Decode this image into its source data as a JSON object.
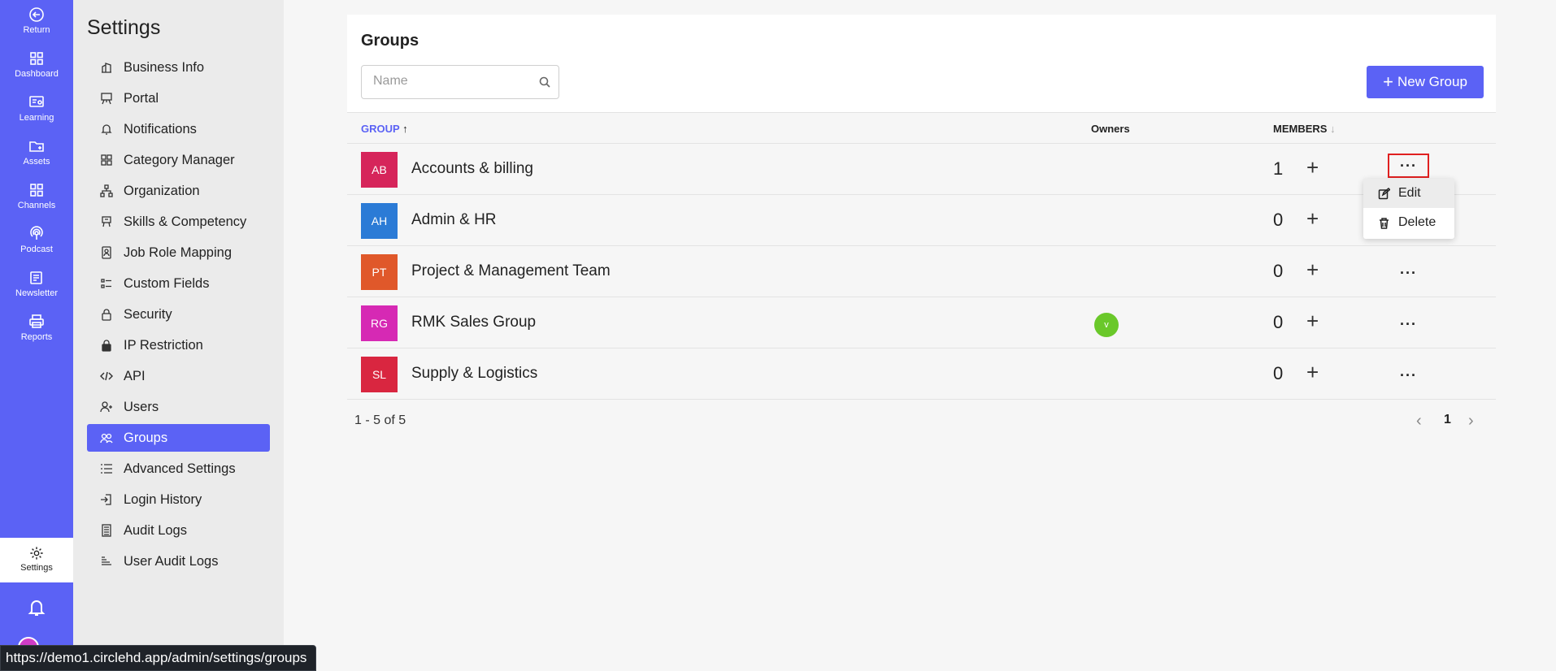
{
  "rail": {
    "items": [
      {
        "label": "Return",
        "icon": "return-icon"
      },
      {
        "label": "Dashboard",
        "icon": "dashboard-icon"
      },
      {
        "label": "Learning",
        "icon": "learning-icon"
      },
      {
        "label": "Assets",
        "icon": "assets-icon"
      },
      {
        "label": "Channels",
        "icon": "channels-icon"
      },
      {
        "label": "Podcast",
        "icon": "podcast-icon"
      },
      {
        "label": "Newsletter",
        "icon": "newsletter-icon"
      },
      {
        "label": "Reports",
        "icon": "reports-icon"
      }
    ],
    "settings_label": "Settings"
  },
  "settings": {
    "title": "Settings",
    "menu": [
      {
        "label": "Business Info",
        "icon": "building-icon"
      },
      {
        "label": "Portal",
        "icon": "easel-icon"
      },
      {
        "label": "Notifications",
        "icon": "bell-icon"
      },
      {
        "label": "Category Manager",
        "icon": "grid-icon"
      },
      {
        "label": "Organization",
        "icon": "org-chart-icon"
      },
      {
        "label": "Skills & Competency",
        "icon": "skills-icon"
      },
      {
        "label": "Job Role Mapping",
        "icon": "id-badge-icon"
      },
      {
        "label": "Custom Fields",
        "icon": "fields-icon"
      },
      {
        "label": "Security",
        "icon": "lock-open-icon"
      },
      {
        "label": "IP Restriction",
        "icon": "lock-icon"
      },
      {
        "label": "API",
        "icon": "code-icon"
      },
      {
        "label": "Users",
        "icon": "user-add-icon"
      },
      {
        "label": "Groups",
        "icon": "users-icon",
        "active": true
      },
      {
        "label": "Advanced Settings",
        "icon": "list-icon"
      },
      {
        "label": "Login History",
        "icon": "login-icon"
      },
      {
        "label": "Audit Logs",
        "icon": "audit-icon"
      },
      {
        "label": "User Audit Logs",
        "icon": "user-audit-icon"
      }
    ]
  },
  "main": {
    "title": "Groups",
    "search_placeholder": "Name",
    "new_group_label": "New Group",
    "columns": {
      "group": "GROUP",
      "group_sort": "↑",
      "owners": "Owners",
      "members": "MEMBERS",
      "members_sort": "↓"
    },
    "rows": [
      {
        "initials": "AB",
        "color": "#d6255b",
        "name": "Accounts & billing",
        "owner": "",
        "members": "1"
      },
      {
        "initials": "AH",
        "color": "#2b7bd6",
        "name": "Admin & HR",
        "owner": "",
        "members": "0"
      },
      {
        "initials": "PT",
        "color": "#e0582a",
        "name": "Project & Management Team",
        "owner": "",
        "members": "0"
      },
      {
        "initials": "RG",
        "color": "#d629b4",
        "name": "RMK Sales Group",
        "owner": "v",
        "members": "0"
      },
      {
        "initials": "SL",
        "color": "#d92640",
        "name": "Supply & Logistics",
        "owner": "",
        "members": "0"
      }
    ],
    "row_menu": {
      "edit": "Edit",
      "delete": "Delete"
    },
    "pagination": {
      "info": "1 - 5 of 5",
      "page": "1",
      "prev": "‹",
      "next": "›"
    }
  },
  "status_url": "https://demo1.circlehd.app/admin/settings/groups",
  "colors": {
    "accent": "#5b62f5",
    "highlight": "#e02020"
  }
}
